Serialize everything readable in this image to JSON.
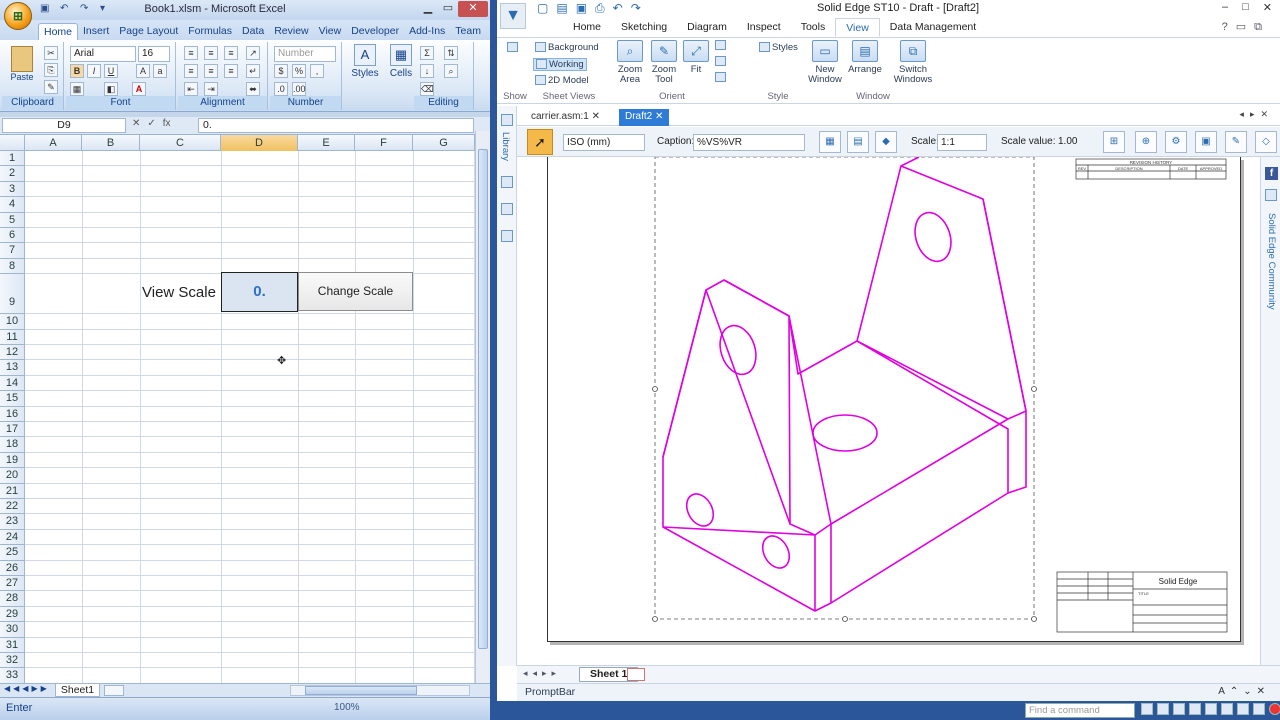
{
  "excel": {
    "window_title": "Book1.xlsm - Microsoft Excel",
    "office_button_label": "Office",
    "tabs": [
      "Home",
      "Insert",
      "Page Layout",
      "Formulas",
      "Data",
      "Review",
      "View",
      "Developer",
      "Add-Ins",
      "Team"
    ],
    "ribbon": {
      "clipboard": {
        "label": "Clipboard",
        "paste": "Paste"
      },
      "font": {
        "label": "Font",
        "name": "Arial",
        "size": "16"
      },
      "alignment": {
        "label": "Alignment"
      },
      "number": {
        "label": "Number",
        "format": "Number"
      },
      "styles": {
        "label": "Styles"
      },
      "cells": {
        "label": "Cells"
      },
      "editing": {
        "label": "Editing"
      }
    },
    "name_box": "D9",
    "formula_value": "0.",
    "columns": [
      "A",
      "B",
      "C",
      "D",
      "E",
      "F",
      "G"
    ],
    "selected_column": "D",
    "rows": [
      "1",
      "2",
      "3",
      "4",
      "5",
      "6",
      "7",
      "8",
      "9",
      "10",
      "11",
      "12",
      "13",
      "14",
      "15",
      "16",
      "17",
      "18",
      "19",
      "20",
      "21",
      "22",
      "23",
      "24",
      "25",
      "26",
      "27",
      "28",
      "29",
      "30",
      "31",
      "32",
      "33"
    ],
    "view_scale_label": "View Scale",
    "d9_value": "0.",
    "change_scale_button": "Change Scale",
    "sheet_tab": "Sheet1",
    "status_mode": "Enter",
    "zoom_text": "100%"
  },
  "solid_edge": {
    "window_title": "Solid Edge ST10 - Draft - [Draft2]",
    "tabs": [
      "Home",
      "Sketching",
      "Diagram",
      "Inspect",
      "Tools",
      "View",
      "Data Management"
    ],
    "active_tab": "View",
    "ribbon": {
      "show": {
        "label": "Show"
      },
      "sheet_views": {
        "label": "Sheet Views",
        "background": "Background",
        "working": "Working",
        "model_2d": "2D Model"
      },
      "orient": {
        "label": "Orient",
        "zoom_area": "Zoom Area",
        "zoom_tool": "Zoom Tool",
        "fit": "Fit"
      },
      "style": {
        "label": "Style",
        "styles": "Styles"
      },
      "window": {
        "label": "Window",
        "new_window": "New Window",
        "arrange": "Arrange",
        "switch_windows": "Switch Windows"
      }
    },
    "library_label": "Library",
    "doc_tabs": [
      "carrier.asm:1",
      "Draft2"
    ],
    "active_doc": "Draft2",
    "command_bar": {
      "standard": "ISO (mm)",
      "caption_label": "Caption:",
      "caption_value": "%VS%VR",
      "scale_label": "Scale:",
      "scale_value": "1:1",
      "scale_value_label": "Scale value:",
      "scale_value_number": "1.00"
    },
    "title_block": {
      "revision_history": "REVISION HISTORY",
      "rev": "REV",
      "description": "DESCRIPTION",
      "date": "DATE",
      "approved": "APPROVED",
      "brand": "Solid Edge",
      "title": "TITLE"
    },
    "community_label": "Solid Edge Community",
    "sheet_tab": "Sheet 1",
    "prompt_bar": "PromptBar",
    "find_command_placeholder": "Find a command",
    "colors": {
      "drawing_lines": "#e000e0",
      "accent": "#2b579a"
    }
  }
}
